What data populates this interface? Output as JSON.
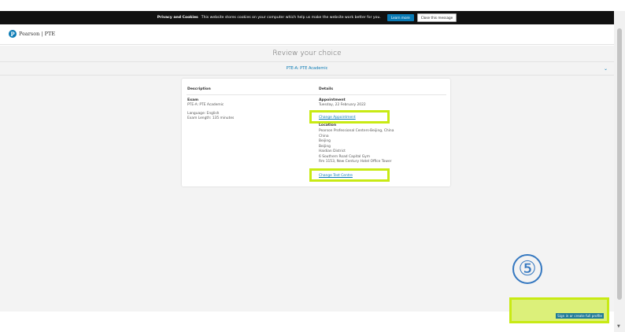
{
  "cookie_bar": {
    "title": "Privacy and Cookies",
    "message": "This website stores cookies on your computer which help us make the website work better for you.",
    "learn_more": "Learn more",
    "close": "Close this message"
  },
  "header": {
    "logo_mark": "P",
    "logo_text": "Pearson | PTE"
  },
  "page": {
    "title": "Review your choice",
    "exam_selector": "PTE-A: PTE Academic"
  },
  "card": {
    "description_heading": "Description",
    "details_heading": "Details",
    "exam_label": "Exam",
    "exam_value": "PTE-A: PTE Academic",
    "language": "Language: English",
    "exam_length": "Exam Length: 135 minutes",
    "appointment_label": "Appointment",
    "appointment_value": "Tuesday, 22 February 2022",
    "change_appointment": "Change Appointment",
    "location_label": "Location",
    "location_lines": [
      "Pearson Professional Centers-Beijing, China",
      "China",
      "Beijing",
      "Beijing",
      "Haidian District",
      "6 Southern Road Capital Gym",
      "Rm 1153, New Century Hotel Office Tower"
    ],
    "change_test_centre": "Change Test Centre"
  },
  "annotation": {
    "step": "⑤"
  },
  "footer": {
    "signin": "Sign in or create full profile"
  },
  "colors": {
    "highlight": "#c8ea14",
    "brand_blue": "#0a7bb5",
    "cookie_bar": "#111111"
  }
}
